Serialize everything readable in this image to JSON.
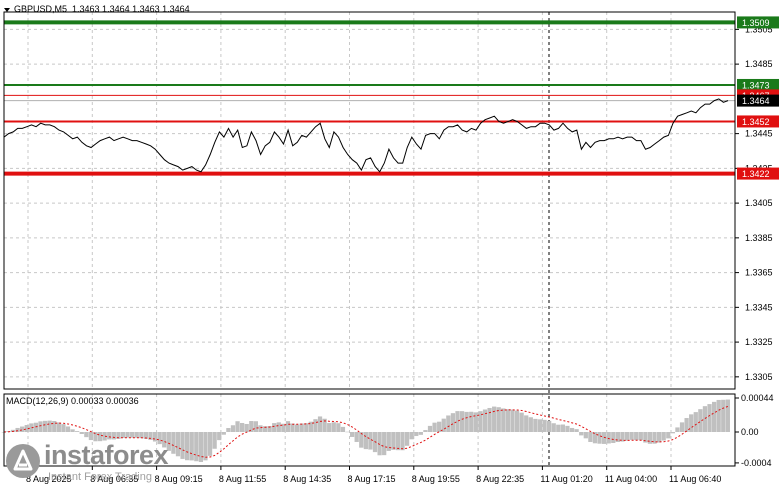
{
  "symbol_bar": {
    "symbol": "GBPUSD,M5",
    "ohlc": "1.3463 1.3464 1.3463 1.3464"
  },
  "price_axis": {
    "ticks": [
      {
        "value": 1.3505,
        "label": "1.3505"
      },
      {
        "value": 1.3485,
        "label": "1.3485"
      },
      {
        "value": 1.3445,
        "label": "1.3445"
      },
      {
        "value": 1.3425,
        "label": "1.3425"
      },
      {
        "value": 1.3405,
        "label": "1.3405"
      },
      {
        "value": 1.3385,
        "label": "1.3385"
      },
      {
        "value": 1.3365,
        "label": "1.3365"
      },
      {
        "value": 1.3345,
        "label": "1.3345"
      },
      {
        "value": 1.3325,
        "label": "1.3325"
      },
      {
        "value": 1.3305,
        "label": "1.3305"
      }
    ]
  },
  "levels": [
    {
      "value": 1.3509,
      "label": "1.3509",
      "color": "#1a7a1a",
      "kind": "resistance-target"
    },
    {
      "value": 1.3473,
      "label": "1.3473",
      "color": "#1a7a1a",
      "kind": "buy-entry"
    },
    {
      "value": 1.3467,
      "label": "1.3467",
      "color": "#e01010",
      "kind": "sell-level-hidden"
    },
    {
      "value": 1.3452,
      "label": "1.3452",
      "color": "#e01010",
      "kind": "sell-entry"
    },
    {
      "value": 1.3422,
      "label": "1.3422",
      "color": "#e01010",
      "kind": "support-target"
    }
  ],
  "current_price": {
    "value": 1.3464,
    "label": "1.3464"
  },
  "time_axis": {
    "labels": [
      "8 Aug 2025",
      "8 Aug 06:35",
      "8 Aug 09:15",
      "8 Aug 11:55",
      "8 Aug 14:35",
      "8 Aug 17:15",
      "8 Aug 19:55",
      "8 Aug 22:35",
      "11 Aug 01:20",
      "11 Aug 04:00",
      "11 Aug 06:40"
    ]
  },
  "macd": {
    "label": "MACD(12,26,9) 0.00033 0.00036",
    "axis_ticks": [
      {
        "value": 0.00044,
        "label": "0.00044"
      },
      {
        "value": 0.0,
        "label": "0.00"
      },
      {
        "value": -0.0004,
        "label": "-0.0004"
      }
    ]
  },
  "watermark": {
    "brand": "instaforex",
    "tagline": "Instant Forex Trading"
  },
  "colors": {
    "price_line": "#000000",
    "green_level": "#1a7a1a",
    "red_level": "#e01010",
    "grid": "#c8c8c8",
    "macd_histogram": "#c0c0c0",
    "macd_signal": "#e01010"
  },
  "chart_data": {
    "type": "line",
    "title": "GBPUSD,M5",
    "ylim": [
      1.3298,
      1.3515
    ],
    "x": [
      "8 Aug 2025",
      "8 Aug 06:35",
      "8 Aug 09:15",
      "8 Aug 11:55",
      "8 Aug 14:35",
      "8 Aug 17:15",
      "8 Aug 19:55",
      "8 Aug 22:35",
      "11 Aug 01:20",
      "11 Aug 04:00",
      "11 Aug 06:40"
    ],
    "series": [
      {
        "values": [
          1.3443,
          1.3445,
          1.3446,
          1.3448,
          1.3448,
          1.3449,
          1.345,
          1.3449,
          1.3451,
          1.345,
          1.345,
          1.3449,
          1.3447,
          1.3446,
          1.3444,
          1.3442,
          1.3443,
          1.344,
          1.3438,
          1.3437,
          1.3439,
          1.3441,
          1.3442,
          1.3443,
          1.3441,
          1.3442,
          1.3443,
          1.3442,
          1.3441,
          1.3441,
          1.344,
          1.3439,
          1.3438,
          1.3436,
          1.3433,
          1.343,
          1.3428,
          1.3427,
          1.3426,
          1.3424,
          1.3425,
          1.3426,
          1.3424,
          1.3423,
          1.3427,
          1.3433,
          1.344,
          1.3446,
          1.3443,
          1.3448,
          1.3443,
          1.3447,
          1.3437,
          1.3438,
          1.3446,
          1.3441,
          1.3433,
          1.3438,
          1.344,
          1.3446,
          1.3443,
          1.3439,
          1.3447,
          1.3438,
          1.344,
          1.3444,
          1.3443,
          1.3446,
          1.3449,
          1.3451,
          1.3442,
          1.3437,
          1.3446,
          1.3443,
          1.3437,
          1.3433,
          1.343,
          1.3428,
          1.3424,
          1.343,
          1.3431,
          1.3426,
          1.3423,
          1.3428,
          1.3436,
          1.3431,
          1.3428,
          1.3428,
          1.3437,
          1.3443,
          1.3439,
          1.3436,
          1.3444,
          1.3445,
          1.3445,
          1.3442,
          1.3447,
          1.3449,
          1.3449,
          1.345,
          1.3447,
          1.3446,
          1.3448,
          1.3447,
          1.3451,
          1.3453,
          1.3454,
          1.3455,
          1.3452,
          1.3451,
          1.3452,
          1.3453,
          1.3452,
          1.345,
          1.3448,
          1.3449,
          1.3449,
          1.3451,
          1.3451,
          1.345,
          1.3447,
          1.3448,
          1.3451,
          1.3448,
          1.3446,
          1.3447,
          1.3436,
          1.344,
          1.3437,
          1.344,
          1.3441,
          1.3441,
          1.3442,
          1.3442,
          1.3443,
          1.3442,
          1.3443,
          1.3443,
          1.3441,
          1.3441,
          1.3436,
          1.3437,
          1.3439,
          1.3441,
          1.3443,
          1.3444,
          1.3451,
          1.3455,
          1.3456,
          1.3457,
          1.3458,
          1.3457,
          1.346,
          1.3462,
          1.3462,
          1.3464,
          1.3465,
          1.3463,
          1.3464
        ]
      }
    ]
  }
}
